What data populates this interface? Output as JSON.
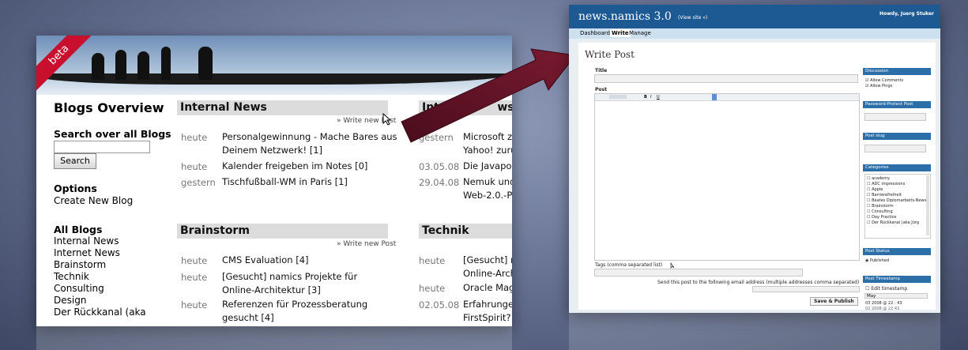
{
  "left": {
    "beta_label": "beta",
    "blogs_overview": "Blogs Overview",
    "search_heading": "Search over all Blogs",
    "search_button": "Search",
    "options_heading": "Options",
    "create_new_blog": "Create New Blog",
    "all_blogs_heading": "All Blogs",
    "all_blogs": [
      "Internal News",
      "Internet News",
      "Brainstorm",
      "Technik",
      "Consulting",
      "Design",
      "Der Rückkanal (aka"
    ],
    "internal_news": {
      "title": "Internal News",
      "write_new_post": "» Write new Post",
      "items": [
        {
          "date": "heute",
          "line1": "Personalgewinnung - Mache Bares aus",
          "line2": "Deinem Netzwerk! [1]"
        },
        {
          "date": "heute",
          "line1": "Kalender freigeben im Notes [0]",
          "line2": ""
        },
        {
          "date": "gestern",
          "line1": "Tischfußball-WM in Paris [1]",
          "line2": ""
        }
      ]
    },
    "internet_news": {
      "title_visible": "Inte",
      "title_tail": "ws",
      "items": [
        {
          "date": "gestern",
          "line1": "Microsoft zi",
          "line2": "Yahoo! zurü"
        },
        {
          "date": "03.05.08",
          "line1": "Die Javapol",
          "line2": ""
        },
        {
          "date": "29.04.08",
          "line1": "Nemuk und",
          "line2": "Web-2.0.-P"
        }
      ]
    },
    "brainstorm": {
      "title": "Brainstorm",
      "write_new_post": "» Write new Post",
      "items": [
        {
          "date": "heute",
          "line1": "CMS Evaluation [4]",
          "line2": ""
        },
        {
          "date": "heute",
          "line1": "[Gesucht] namics Projekte für",
          "line2": "Online-Architektur [3]"
        },
        {
          "date": "heute",
          "line1": "Referenzen für Prozessberatung",
          "line2": "gesucht [4]"
        }
      ]
    },
    "technik": {
      "title": "Technik",
      "items": [
        {
          "date": "heute",
          "line1": "[Gesucht] r",
          "line2": "Online-Arch"
        },
        {
          "date": "heute",
          "line1": "Oracle Mag",
          "line2": ""
        },
        {
          "date": "02.05.08",
          "line1": "Erfahrunge",
          "line2": "FirstSpirit?"
        }
      ]
    }
  },
  "right": {
    "app_title": "news.namics 3.0",
    "view_site": "(View site »)",
    "howdy": "Howdy, Juerg Stuker",
    "nav": [
      "Dashboard",
      "Write",
      "Manage"
    ],
    "page_title": "Write Post",
    "title_label": "Title",
    "post_label": "Post",
    "tags_label": "Tags (comma separated list)",
    "email_label": "Send this post to the following email address (multiple addresses comma separated)",
    "save_publish": "Save & Publish",
    "discussion": "Discussion",
    "allow_comments": "Allow Comments",
    "allow_pings": "Allow Pings",
    "password_protect": "Password-Protect Post",
    "post_slug": "Post slug",
    "categories": "Categories",
    "category_items": [
      "academy",
      "ADC impressions",
      "Apple",
      "Barrierefreiheit",
      "Beates Diplomarbeits-News",
      "Brainstorm",
      "Consulting",
      "Day Practice",
      "Der Rückkanal (aka Jürg"
    ],
    "post_status": "Post Status",
    "published": "Published",
    "post_timestamp": "Post Timestamp",
    "edit_timestamp": "Edit timestamp",
    "month": "May",
    "ts_row1": [
      "03",
      "2008",
      "@",
      "22",
      ":",
      "43"
    ],
    "ts_row2": [
      "02",
      "2008",
      "@",
      "22",
      "43"
    ]
  }
}
